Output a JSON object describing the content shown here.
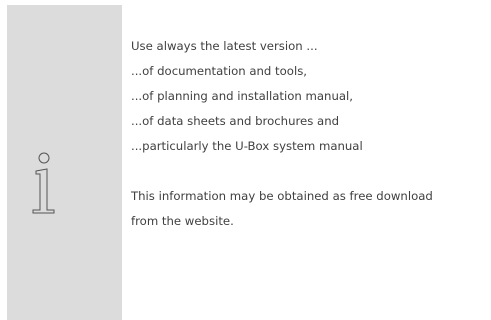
{
  "notice": {
    "icon": "info-icon",
    "lines": [
      "Use always the latest version ...",
      "...of documentation and tools,",
      "...of planning and installation manual,",
      "...of data sheets and brochures and",
      "...particularly the U-Box system manual"
    ],
    "footer_lines": [
      "This information may be obtained as free download",
      "from the website."
    ]
  },
  "colors": {
    "sidebar": "#dcdcdc",
    "text": "#404040",
    "icon_stroke": "#555555"
  }
}
